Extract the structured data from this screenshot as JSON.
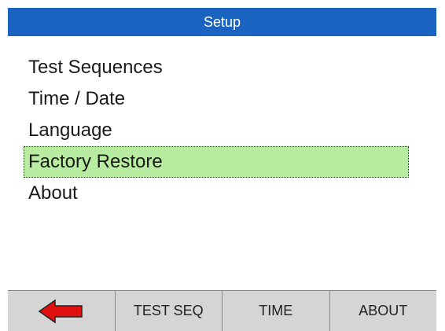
{
  "header": {
    "title": "Setup"
  },
  "menu": {
    "items": [
      {
        "label": "Test Sequences",
        "selected": false
      },
      {
        "label": "Time / Date",
        "selected": false
      },
      {
        "label": "Language",
        "selected": false
      },
      {
        "label": "Factory Restore",
        "selected": true
      },
      {
        "label": "About",
        "selected": false
      }
    ]
  },
  "softkeys": {
    "back_icon": "left-arrow-icon",
    "test_seq_label": "TEST SEQ",
    "time_label": "TIME",
    "about_label": "ABOUT"
  },
  "colors": {
    "header_bg": "#1b63c0",
    "selected_bg": "#b8eca0",
    "softkey_bg": "#d5d5d5",
    "arrow": "#e01010"
  }
}
